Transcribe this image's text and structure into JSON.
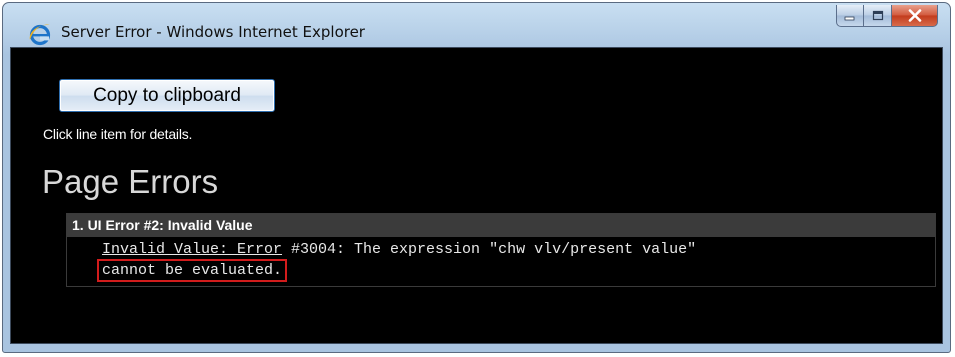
{
  "window": {
    "title": "Server Error - Windows Internet Explorer",
    "app_icon": "internet-explorer-icon",
    "controls": {
      "minimize_icon": "minimize-icon",
      "maximize_icon": "maximize-icon",
      "close_icon": "close-icon"
    }
  },
  "toolbar": {
    "copy_label": "Copy to clipboard"
  },
  "hint": "Click line item for details.",
  "page_title": "Page Errors",
  "errors": [
    {
      "header": "1. UI Error #2: Invalid Value",
      "message_part1_underlined": "Invalid Value: Error",
      "message_part2": " #3004: The expression \"chw vlv/present value\"",
      "message_line2_highlighted": "cannot be evaluated."
    }
  ],
  "colors": {
    "client_background": "#000000",
    "highlight_border": "#d21c1c",
    "header_background": "#3b3b3b"
  }
}
